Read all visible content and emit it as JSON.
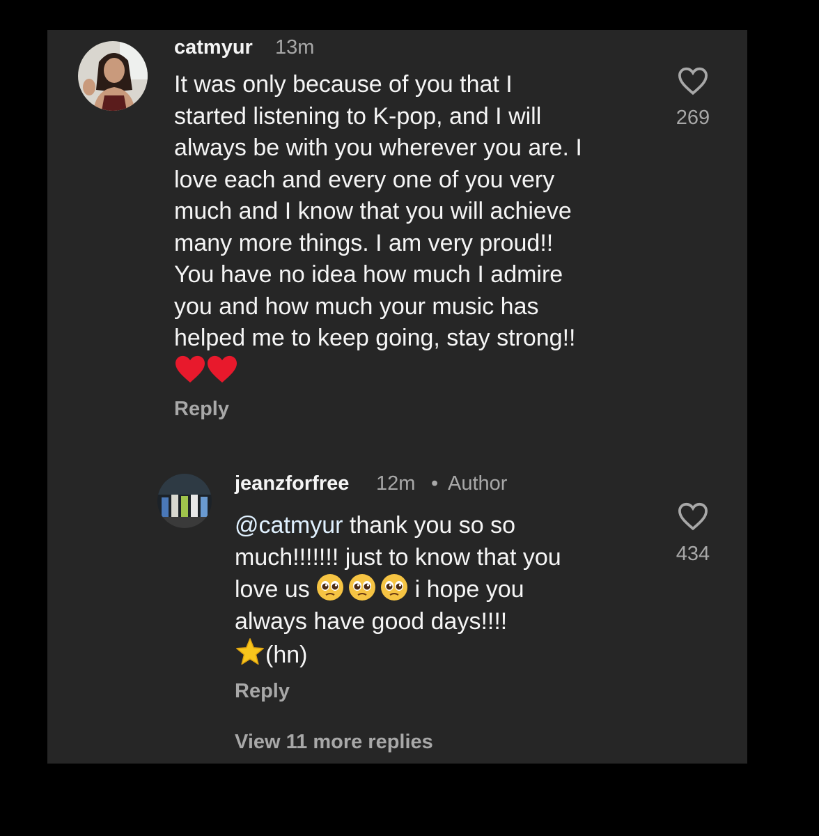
{
  "comment": {
    "username": "catmyur",
    "time": "13m",
    "text_lines": [
      "It was only because of you that I",
      "started listening to K-pop, and I will",
      "always be with you wherever you are. I",
      "love each and every one of you very",
      "much and I know that you will achieve",
      "many more things. I am very proud!!",
      "You have no idea how much I admire",
      "you and how much your music has",
      "helped me to keep going, stay strong!!"
    ],
    "emoji_line": "❤️❤️",
    "likes": "269",
    "reply_label": "Reply"
  },
  "reply": {
    "username": "jeanzforfree",
    "time": "12m",
    "separator": "•",
    "badge": "Author",
    "mention": "@catmyur",
    "line1_rest": " thank you so so",
    "line2": "much!!!!!!! just to know that you",
    "line3_start": "love us ",
    "line3_end": " i hope you",
    "line4": "always have good days!!!!",
    "line5_text": "(hn)",
    "likes": "434",
    "reply_label": "Reply"
  },
  "view_more_label": "View 11 more replies",
  "icons": {
    "like": "heart-outline-icon",
    "heart_emoji": "red-heart-emoji",
    "pleading_emoji": "pleading-face-emoji",
    "star_emoji": "star-emoji"
  },
  "colors": {
    "background": "#262626",
    "primary_text": "#f5f5f5",
    "secondary_text": "#a8a8a8",
    "heart_red": "#e8192c",
    "star_yellow": "#f8c61c"
  }
}
